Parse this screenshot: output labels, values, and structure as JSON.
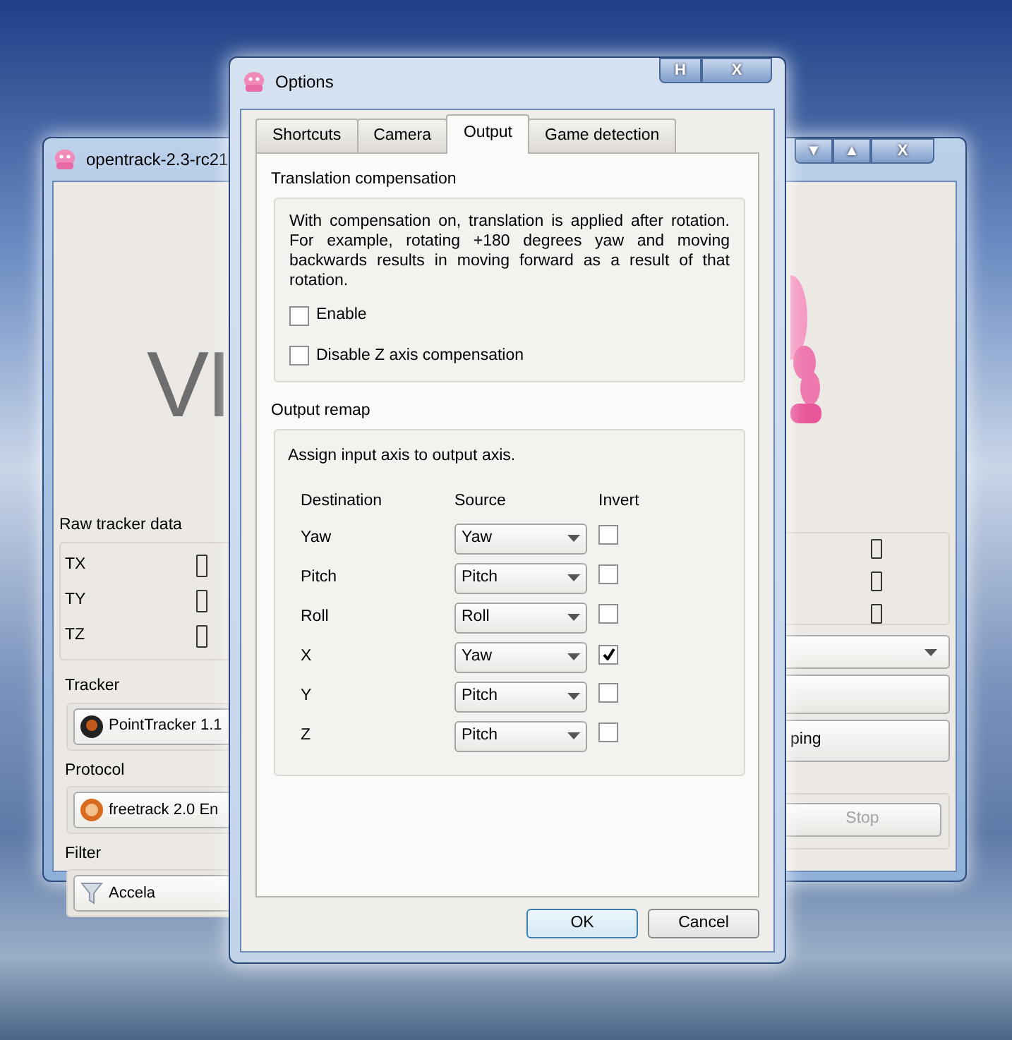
{
  "main_window": {
    "title": "opentrack-2.3-rc21",
    "title_buttons": [
      "▼",
      "▲",
      "X"
    ],
    "logo_text": "VI",
    "raw_tracker_data": {
      "title": "Raw tracker data",
      "axes": [
        "TX",
        "TY",
        "TZ"
      ]
    },
    "modules": [
      {
        "label": "Tracker",
        "value": "PointTracker 1.1",
        "kind": "tracker"
      },
      {
        "label": "Protocol",
        "value": "freetrack 2.0 En",
        "kind": "protocol"
      },
      {
        "label": "Filter",
        "value": "Accela",
        "kind": "filter"
      }
    ],
    "buttons": [
      {
        "label": "ping",
        "disabled": false
      },
      {
        "label": "Stop",
        "disabled": true
      }
    ]
  },
  "options_dialog": {
    "title": "Options",
    "title_buttons": [
      "H",
      "X"
    ],
    "tabs": [
      {
        "label": "Shortcuts",
        "selected": false
      },
      {
        "label": "Camera",
        "selected": false
      },
      {
        "label": "Output",
        "selected": true
      },
      {
        "label": "Game detection",
        "selected": false
      }
    ],
    "translation_compensation": {
      "title": "Translation compensation",
      "description": "With compensation on, translation is applied after rotation. For example, rotating +180 degrees yaw and moving backwards results in moving forward as a result of that rotation.",
      "options": [
        {
          "label": "Enable",
          "checked": false
        },
        {
          "label": "Disable Z axis compensation",
          "checked": false
        }
      ]
    },
    "output_remap": {
      "title": "Output remap",
      "description": "Assign input axis to output axis.",
      "columns": [
        "Destination",
        "Source",
        "Invert"
      ],
      "rows": [
        {
          "destination": "Yaw",
          "source": "Yaw",
          "invert": false
        },
        {
          "destination": "Pitch",
          "source": "Pitch",
          "invert": false
        },
        {
          "destination": "Roll",
          "source": "Roll",
          "invert": false
        },
        {
          "destination": "X",
          "source": "Yaw",
          "invert": true
        },
        {
          "destination": "Y",
          "source": "Pitch",
          "invert": false
        },
        {
          "destination": "Z",
          "source": "Pitch",
          "invert": false
        }
      ]
    },
    "buttons": [
      {
        "label": "OK",
        "default": true
      },
      {
        "label": "Cancel",
        "default": false
      }
    ]
  }
}
